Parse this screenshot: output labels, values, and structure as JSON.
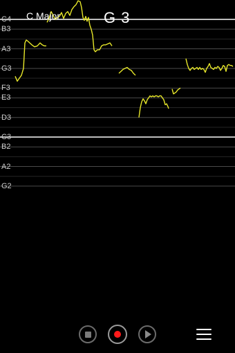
{
  "header": {
    "key": "C Major",
    "current_note": "G 3"
  },
  "scale": {
    "labels": [
      "C4",
      "B3",
      "A3",
      "G3",
      "F3",
      "E3",
      "D3",
      "C3",
      "B2",
      "A2",
      "G2"
    ],
    "semitones": [
      60,
      59,
      57,
      55,
      53,
      52,
      50,
      48,
      47,
      45,
      43
    ],
    "octave_marks": [
      60,
      48
    ]
  },
  "pitch_trace": {
    "segments": [
      [
        [
          22,
          54.2
        ],
        [
          25,
          53.7
        ],
        [
          28,
          54.0
        ],
        [
          31,
          54.3
        ],
        [
          34,
          55.0
        ],
        [
          36,
          57.6
        ],
        [
          38,
          57.9
        ],
        [
          40,
          57.8
        ],
        [
          43,
          57.6
        ],
        [
          46,
          57.4
        ],
        [
          50,
          57.2
        ],
        [
          54,
          57.3
        ],
        [
          58,
          57.6
        ],
        [
          61,
          57.4
        ],
        [
          64,
          57.3
        ],
        [
          67,
          57.3
        ]
      ],
      [
        [
          68,
          59.7
        ],
        [
          71,
          60.1
        ],
        [
          74,
          60.8
        ],
        [
          77,
          60.4
        ],
        [
          80,
          60.0
        ],
        [
          83,
          60.2
        ],
        [
          86,
          60.3
        ],
        [
          89,
          60.7
        ],
        [
          92,
          60.1
        ],
        [
          95,
          60.6
        ],
        [
          98,
          60.8
        ],
        [
          101,
          60.4
        ],
        [
          104,
          61.0
        ],
        [
          107,
          61.3
        ],
        [
          110,
          61.5
        ],
        [
          113,
          61.9
        ],
        [
          116,
          61.8
        ],
        [
          118,
          61.2
        ],
        [
          120,
          60.2
        ],
        [
          122,
          59.9
        ],
        [
          124,
          60.3
        ],
        [
          126,
          59.8
        ],
        [
          128,
          60.2
        ],
        [
          130,
          59.4
        ],
        [
          132,
          59.0
        ],
        [
          134,
          58.4
        ],
        [
          136,
          56.9
        ],
        [
          138,
          56.7
        ],
        [
          141,
          56.9
        ],
        [
          144,
          56.9
        ],
        [
          147,
          57.3
        ],
        [
          150,
          57.4
        ],
        [
          153,
          57.4
        ],
        [
          156,
          57.5
        ],
        [
          159,
          57.6
        ],
        [
          162,
          57.3
        ]
      ],
      [
        [
          172,
          54.5
        ],
        [
          175,
          54.7
        ],
        [
          178,
          54.9
        ],
        [
          181,
          55.0
        ],
        [
          184,
          55.1
        ],
        [
          187,
          54.9
        ],
        [
          190,
          54.8
        ],
        [
          193,
          54.5
        ],
        [
          196,
          54.3
        ]
      ],
      [
        [
          201,
          50.0
        ],
        [
          203,
          51.0
        ],
        [
          205,
          51.6
        ],
        [
          207,
          51.9
        ],
        [
          209,
          51.7
        ],
        [
          211,
          51.4
        ],
        [
          213,
          51.8
        ],
        [
          215,
          52.0
        ],
        [
          217,
          52.2
        ],
        [
          219,
          52.1
        ],
        [
          221,
          52.2
        ],
        [
          223,
          52.1
        ],
        [
          225,
          52.2
        ],
        [
          227,
          52.2
        ],
        [
          229,
          52.1
        ],
        [
          231,
          52.2
        ],
        [
          233,
          52.2
        ],
        [
          235,
          52.0
        ],
        [
          237,
          51.8
        ],
        [
          239,
          51.3
        ],
        [
          241,
          51.4
        ],
        [
          243,
          51.1
        ],
        [
          244,
          50.9
        ]
      ],
      [
        [
          249,
          52.9
        ],
        [
          251,
          52.4
        ],
        [
          253,
          52.5
        ],
        [
          255,
          52.6
        ],
        [
          257,
          52.8
        ],
        [
          259,
          52.9
        ],
        [
          261,
          53.0
        ]
      ],
      [
        [
          269,
          56.0
        ],
        [
          271,
          55.4
        ],
        [
          273,
          55.0
        ],
        [
          275,
          54.8
        ],
        [
          277,
          55.0
        ],
        [
          279,
          55.1
        ],
        [
          281,
          54.9
        ],
        [
          283,
          55.0
        ],
        [
          285,
          55.1
        ],
        [
          287,
          54.9
        ],
        [
          289,
          55.1
        ],
        [
          291,
          54.9
        ],
        [
          293,
          55.0
        ],
        [
          295,
          54.9
        ],
        [
          297,
          54.6
        ],
        [
          299,
          55.0
        ],
        [
          301,
          55.2
        ],
        [
          303,
          55.5
        ],
        [
          305,
          55.1
        ],
        [
          307,
          55.0
        ],
        [
          309,
          54.9
        ],
        [
          311,
          55.1
        ],
        [
          313,
          55.0
        ],
        [
          315,
          55.2
        ],
        [
          317,
          55.1
        ],
        [
          319,
          54.8
        ],
        [
          321,
          55.0
        ],
        [
          323,
          55.3
        ],
        [
          325,
          55.2
        ],
        [
          327,
          54.7
        ],
        [
          329,
          55.3
        ],
        [
          331,
          55.4
        ],
        [
          333,
          55.3
        ],
        [
          335,
          55.3
        ],
        [
          337,
          55.2
        ]
      ]
    ]
  },
  "controls": {
    "stop_icon": "stop-square-icon",
    "record_icon": "record-dot-icon",
    "play_icon": "play-triangle-icon",
    "menu_icon": "hamburger-menu-icon",
    "record_color": "#ff1a1a",
    "trace_color": "#e8e82a"
  }
}
